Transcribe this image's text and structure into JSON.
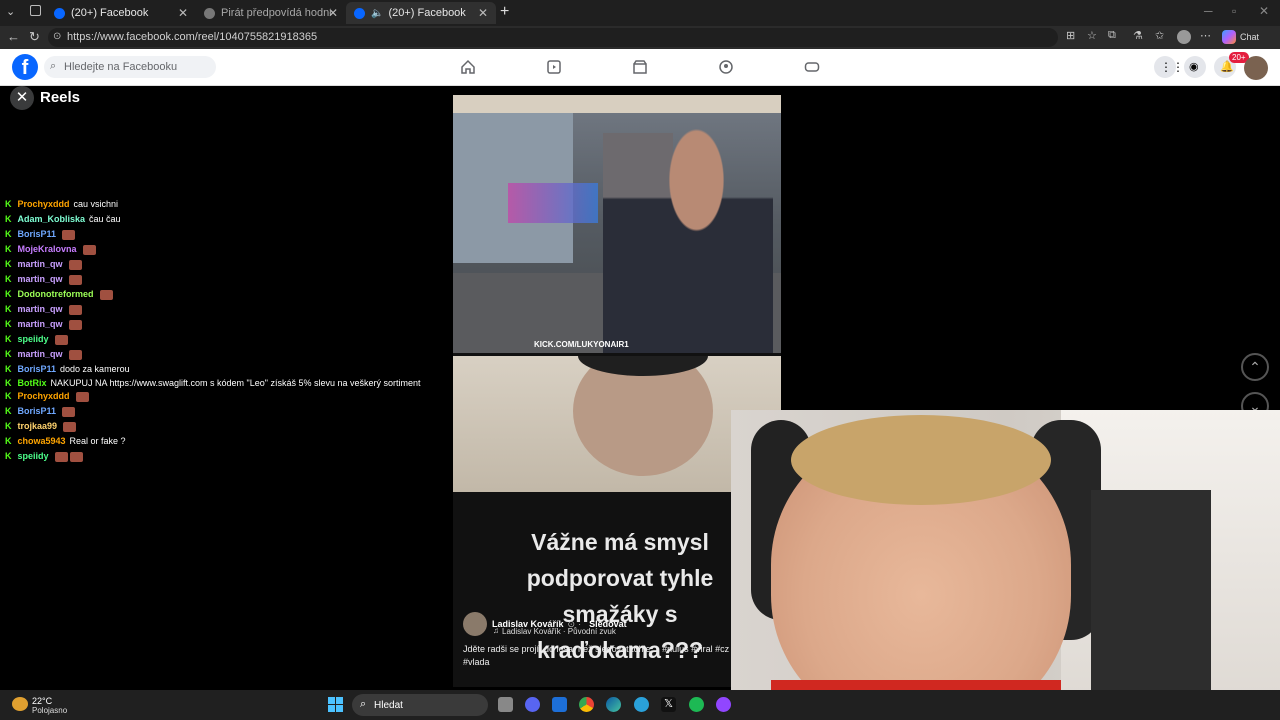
{
  "browser": {
    "tabs": [
      {
        "label": "(20+) Facebook",
        "active": false
      },
      {
        "label": "Pirát předpovídá hodně vyhroceno",
        "active": false
      },
      {
        "label": "(20+) Facebook",
        "active": true
      }
    ],
    "url": "https://www.facebook.com/reel/1040755821918365",
    "chat_label": "Chat"
  },
  "facebook": {
    "search_placeholder": "Hledejte na Facebooku",
    "notification_badge": "20+"
  },
  "reels": {
    "title": "Reels"
  },
  "chat": [
    {
      "user": "Prochyxddd",
      "color": "#ffa500",
      "text": "cau vsichni",
      "emotes": 0
    },
    {
      "user": "Adam_Kobliska",
      "color": "#7fffd4",
      "text": "čau čau",
      "emotes": 0
    },
    {
      "user": "BorisP11",
      "color": "#6fa8ff",
      "text": "",
      "emotes": 1
    },
    {
      "user": "MojeKralovna",
      "color": "#c77dff",
      "text": "",
      "emotes": 1
    },
    {
      "user": "martin_qw",
      "color": "#c9a0ff",
      "text": "",
      "emotes": 1
    },
    {
      "user": "martin_qw",
      "color": "#c9a0ff",
      "text": "",
      "emotes": 1
    },
    {
      "user": "Dodonotreformed",
      "color": "#9cff57",
      "text": "",
      "emotes": 1
    },
    {
      "user": "martin_qw",
      "color": "#c9a0ff",
      "text": "",
      "emotes": 1
    },
    {
      "user": "martin_qw",
      "color": "#c9a0ff",
      "text": "",
      "emotes": 1
    },
    {
      "user": "speiidy",
      "color": "#4cff8a",
      "text": "",
      "emotes": 1
    },
    {
      "user": "martin_qw",
      "color": "#c9a0ff",
      "text": "",
      "emotes": 1
    },
    {
      "user": "BorisP11",
      "color": "#6fa8ff",
      "text": "dodo za kamerou",
      "emotes": 0
    },
    {
      "user": "BotRix",
      "color": "#53fc18",
      "text": "NAKUPUJ NA https://www.swaglift.com s kódem \"Leo\" získáš 5% slevu na veškerý sortiment",
      "emotes": 0,
      "wrap": true
    },
    {
      "user": "Prochyxddd",
      "color": "#ffa500",
      "text": "",
      "emotes": 1
    },
    {
      "user": "BorisP11",
      "color": "#6fa8ff",
      "text": "",
      "emotes": 1
    },
    {
      "user": "trojkaa99",
      "color": "#ffd36e",
      "text": "",
      "emotes": 1
    },
    {
      "user": "chowa5943",
      "color": "#ffa500",
      "text": "Real or fake ?",
      "emotes": 0
    },
    {
      "user": "speiidy",
      "color": "#4cff8a",
      "text": "",
      "emotes": 2
    }
  ],
  "reel": {
    "kick_label": "KICK.COM/LUKYONAIR1",
    "caption": "Vážne má smysl podporovat tyhle smažáky s kraďokama???",
    "author": "Ladislav Kovářík",
    "follow": "Sledovat",
    "sound": "Ladislav Kovářík · Původní zvuk",
    "description": "Jděte radši se projít do lesa, než sledovat tohle… #nulus #viral #cz #vlada"
  },
  "taskbar": {
    "temperature": "22°C",
    "weather": "Polojasno",
    "search_label": "Hledat"
  }
}
